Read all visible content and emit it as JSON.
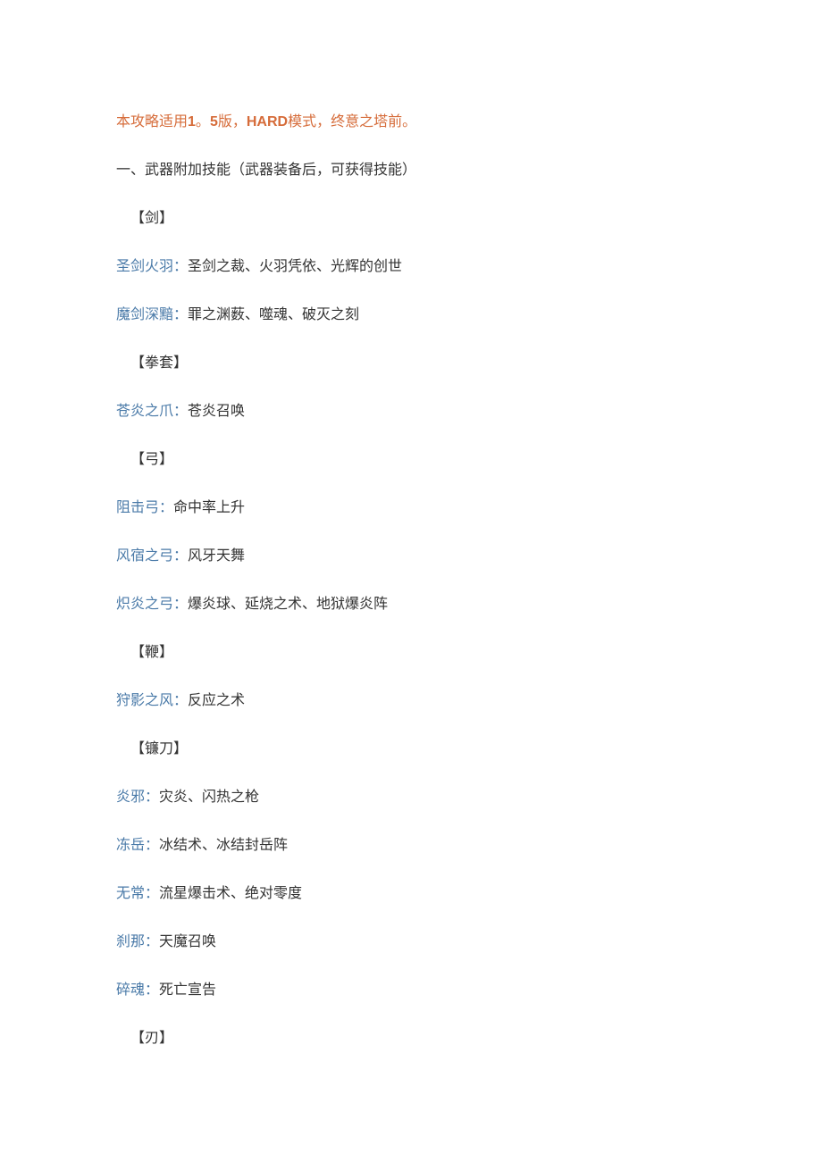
{
  "header": {
    "prefix": "本攻略适用",
    "version1": "1",
    "comma1": "。",
    "version2": "5",
    "version_suffix": "版，",
    "mode": "HARD",
    "suffix": "模式，终意之塔前。"
  },
  "section_title": "一、武器附加技能（武器装备后，可获得技能）",
  "categories": [
    {
      "name": "【剑】",
      "weapons": [
        {
          "name": "圣剑火羽：",
          "skills": "圣剑之裁、火羽凭依、光辉的创世"
        },
        {
          "name": "魔剑深黯：",
          "skills": "罪之渊薮、噬魂、破灭之刻"
        }
      ]
    },
    {
      "name": "【拳套】",
      "weapons": [
        {
          "name": "苍炎之爪：",
          "skills": "苍炎召唤"
        }
      ]
    },
    {
      "name": "【弓】",
      "weapons": [
        {
          "name": "阻击弓：",
          "skills": "命中率上升"
        },
        {
          "name": "风宿之弓：",
          "skills": "风牙天舞"
        },
        {
          "name": "炽炎之弓：",
          "skills": "爆炎球、延烧之术、地狱爆炎阵"
        }
      ]
    },
    {
      "name": "【鞭】",
      "weapons": [
        {
          "name": "狩影之风：",
          "skills": "反应之术"
        }
      ]
    },
    {
      "name": "【镰刀】",
      "weapons": [
        {
          "name": "炎邪：",
          "skills": "灾炎、闪热之枪"
        },
        {
          "name": "冻岳：",
          "skills": "冰结术、冰结封岳阵"
        },
        {
          "name": "无常：",
          "skills": "流星爆击术、绝对零度"
        },
        {
          "name": "刹那：",
          "skills": "天魔召唤"
        },
        {
          "name": "碎魂：",
          "skills": "死亡宣告"
        }
      ]
    },
    {
      "name": "【刃】",
      "weapons": []
    }
  ]
}
